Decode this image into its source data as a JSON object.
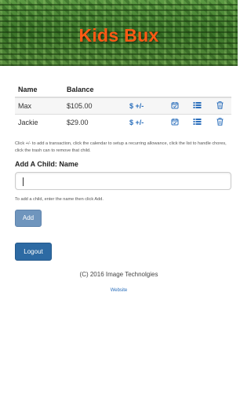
{
  "app": {
    "title": "Kids Bux",
    "accent_color": "#ff5a14",
    "banner_color": "#3f7a2c"
  },
  "table": {
    "headers": {
      "name": "Name",
      "balance": "Balance"
    },
    "rows": [
      {
        "name": "Max",
        "balance": "$105.00",
        "transaction_label": "$ +/-",
        "icons": [
          "calendar-icon",
          "list-icon",
          "trash-icon"
        ]
      },
      {
        "name": "Jackie",
        "balance": "$29.00",
        "transaction_label": "$ +/-",
        "icons": [
          "calendar-icon",
          "list-icon",
          "trash-icon"
        ]
      }
    ]
  },
  "help_text": "Click +/- to add a transaction, click the calendar to setup a recurring allowance, click the list to handle chores, click the trash can to remove that child.",
  "add_child": {
    "label": "Add A Child: Name",
    "input_value": "",
    "hint": "To add a child, enter the name then click Add.",
    "button_label": "Add"
  },
  "logout_label": "Logout",
  "footer": {
    "copyright": "(C) 2016 Image Technolgies",
    "website_link": "Website"
  },
  "colors": {
    "link": "#2a6ebb",
    "add_button": "#6f95bd",
    "logout_button": "#2d6aa3"
  }
}
